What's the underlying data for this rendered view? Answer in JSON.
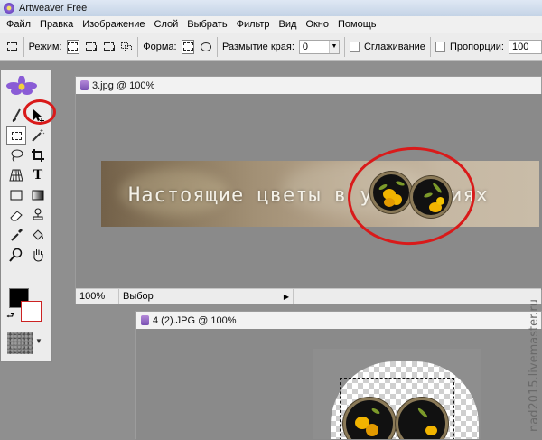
{
  "window": {
    "title": "Artweaver Free",
    "icon": "artweaver-app-icon"
  },
  "menu": [
    "Файл",
    "Правка",
    "Изображение",
    "Слой",
    "Выбрать",
    "Фильтр",
    "Вид",
    "Окно",
    "Помощь"
  ],
  "options_bar": {
    "mode_label": "Режим:",
    "shape_label": "Форма:",
    "feather_label": "Размытие края:",
    "feather_value": "0",
    "antialias_label": "Сглаживание",
    "proportions_label": "Пропорции:",
    "proportions_value": "100"
  },
  "toolbox": {
    "tools": [
      "brush-icon",
      "move-icon",
      "rect-select-icon",
      "magic-wand-icon",
      "lasso-icon",
      "crop-icon",
      "perspective-grid-icon",
      "text-icon",
      "rectangle-shape-icon",
      "gradient-icon",
      "eraser-icon",
      "clone-stamp-icon",
      "eyedropper-icon",
      "paint-bucket-icon",
      "zoom-icon",
      "hand-icon"
    ],
    "foreground_color": "#000000",
    "background_color": "#ffffff"
  },
  "doc1": {
    "title": "3.jpg @ 100%",
    "zoom": "100%",
    "mode": "Выбор",
    "banner_text": "Настоящие цветы в украшениях"
  },
  "doc2": {
    "title": "4 (2).JPG @ 100%"
  },
  "watermark": "nad2015.livemaster.ru",
  "annotation_color": "#d91a1a"
}
